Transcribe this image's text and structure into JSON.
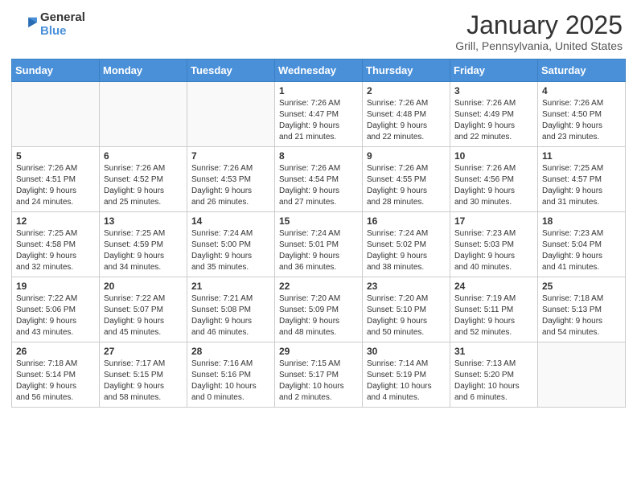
{
  "header": {
    "logo_general": "General",
    "logo_blue": "Blue",
    "month_title": "January 2025",
    "location": "Grill, Pennsylvania, United States"
  },
  "weekdays": [
    "Sunday",
    "Monday",
    "Tuesday",
    "Wednesday",
    "Thursday",
    "Friday",
    "Saturday"
  ],
  "weeks": [
    [
      {
        "day": "",
        "info": ""
      },
      {
        "day": "",
        "info": ""
      },
      {
        "day": "",
        "info": ""
      },
      {
        "day": "1",
        "info": "Sunrise: 7:26 AM\nSunset: 4:47 PM\nDaylight: 9 hours\nand 21 minutes."
      },
      {
        "day": "2",
        "info": "Sunrise: 7:26 AM\nSunset: 4:48 PM\nDaylight: 9 hours\nand 22 minutes."
      },
      {
        "day": "3",
        "info": "Sunrise: 7:26 AM\nSunset: 4:49 PM\nDaylight: 9 hours\nand 22 minutes."
      },
      {
        "day": "4",
        "info": "Sunrise: 7:26 AM\nSunset: 4:50 PM\nDaylight: 9 hours\nand 23 minutes."
      }
    ],
    [
      {
        "day": "5",
        "info": "Sunrise: 7:26 AM\nSunset: 4:51 PM\nDaylight: 9 hours\nand 24 minutes."
      },
      {
        "day": "6",
        "info": "Sunrise: 7:26 AM\nSunset: 4:52 PM\nDaylight: 9 hours\nand 25 minutes."
      },
      {
        "day": "7",
        "info": "Sunrise: 7:26 AM\nSunset: 4:53 PM\nDaylight: 9 hours\nand 26 minutes."
      },
      {
        "day": "8",
        "info": "Sunrise: 7:26 AM\nSunset: 4:54 PM\nDaylight: 9 hours\nand 27 minutes."
      },
      {
        "day": "9",
        "info": "Sunrise: 7:26 AM\nSunset: 4:55 PM\nDaylight: 9 hours\nand 28 minutes."
      },
      {
        "day": "10",
        "info": "Sunrise: 7:26 AM\nSunset: 4:56 PM\nDaylight: 9 hours\nand 30 minutes."
      },
      {
        "day": "11",
        "info": "Sunrise: 7:25 AM\nSunset: 4:57 PM\nDaylight: 9 hours\nand 31 minutes."
      }
    ],
    [
      {
        "day": "12",
        "info": "Sunrise: 7:25 AM\nSunset: 4:58 PM\nDaylight: 9 hours\nand 32 minutes."
      },
      {
        "day": "13",
        "info": "Sunrise: 7:25 AM\nSunset: 4:59 PM\nDaylight: 9 hours\nand 34 minutes."
      },
      {
        "day": "14",
        "info": "Sunrise: 7:24 AM\nSunset: 5:00 PM\nDaylight: 9 hours\nand 35 minutes."
      },
      {
        "day": "15",
        "info": "Sunrise: 7:24 AM\nSunset: 5:01 PM\nDaylight: 9 hours\nand 36 minutes."
      },
      {
        "day": "16",
        "info": "Sunrise: 7:24 AM\nSunset: 5:02 PM\nDaylight: 9 hours\nand 38 minutes."
      },
      {
        "day": "17",
        "info": "Sunrise: 7:23 AM\nSunset: 5:03 PM\nDaylight: 9 hours\nand 40 minutes."
      },
      {
        "day": "18",
        "info": "Sunrise: 7:23 AM\nSunset: 5:04 PM\nDaylight: 9 hours\nand 41 minutes."
      }
    ],
    [
      {
        "day": "19",
        "info": "Sunrise: 7:22 AM\nSunset: 5:06 PM\nDaylight: 9 hours\nand 43 minutes."
      },
      {
        "day": "20",
        "info": "Sunrise: 7:22 AM\nSunset: 5:07 PM\nDaylight: 9 hours\nand 45 minutes."
      },
      {
        "day": "21",
        "info": "Sunrise: 7:21 AM\nSunset: 5:08 PM\nDaylight: 9 hours\nand 46 minutes."
      },
      {
        "day": "22",
        "info": "Sunrise: 7:20 AM\nSunset: 5:09 PM\nDaylight: 9 hours\nand 48 minutes."
      },
      {
        "day": "23",
        "info": "Sunrise: 7:20 AM\nSunset: 5:10 PM\nDaylight: 9 hours\nand 50 minutes."
      },
      {
        "day": "24",
        "info": "Sunrise: 7:19 AM\nSunset: 5:11 PM\nDaylight: 9 hours\nand 52 minutes."
      },
      {
        "day": "25",
        "info": "Sunrise: 7:18 AM\nSunset: 5:13 PM\nDaylight: 9 hours\nand 54 minutes."
      }
    ],
    [
      {
        "day": "26",
        "info": "Sunrise: 7:18 AM\nSunset: 5:14 PM\nDaylight: 9 hours\nand 56 minutes."
      },
      {
        "day": "27",
        "info": "Sunrise: 7:17 AM\nSunset: 5:15 PM\nDaylight: 9 hours\nand 58 minutes."
      },
      {
        "day": "28",
        "info": "Sunrise: 7:16 AM\nSunset: 5:16 PM\nDaylight: 10 hours\nand 0 minutes."
      },
      {
        "day": "29",
        "info": "Sunrise: 7:15 AM\nSunset: 5:17 PM\nDaylight: 10 hours\nand 2 minutes."
      },
      {
        "day": "30",
        "info": "Sunrise: 7:14 AM\nSunset: 5:19 PM\nDaylight: 10 hours\nand 4 minutes."
      },
      {
        "day": "31",
        "info": "Sunrise: 7:13 AM\nSunset: 5:20 PM\nDaylight: 10 hours\nand 6 minutes."
      },
      {
        "day": "",
        "info": ""
      }
    ]
  ]
}
